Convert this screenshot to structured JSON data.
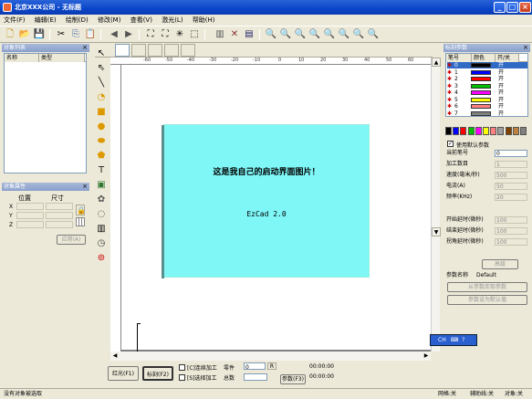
{
  "window": {
    "title": "北京XXX公司 - 无标题"
  },
  "menu": [
    "文件(F)",
    "编辑(E)",
    "绘制(D)",
    "修改(M)",
    "查看(V)",
    "激光(L)",
    "帮助(H)"
  ],
  "object_list": {
    "title": "对象列表",
    "col_name": "名称",
    "col_type": "类型"
  },
  "object_props": {
    "title": "对象属性",
    "col_pos": "位置",
    "col_size": "尺寸",
    "x": "X",
    "y": "Y",
    "z": "Z",
    "apply": "应用(A)"
  },
  "ruler_h": [
    "-60",
    "-50",
    "-40",
    "-30",
    "-20",
    "-10",
    "0",
    "10",
    "20",
    "30",
    "40",
    "50",
    "60"
  ],
  "splash": {
    "line1": "这是我自己的启动界面图片！",
    "line2": "EzCad 2.0"
  },
  "bottom": {
    "red_light": "红光(F1)",
    "mark": "标刻(F2)",
    "continuous": "[C]连续加工",
    "selected": "[S]选择加工",
    "part_label": "零件",
    "part_value": "0",
    "total_label": "总数",
    "param": "参数(F3)",
    "time1": "00:00:00",
    "time2": "00:00:00"
  },
  "pen_params": {
    "title": "标刻参数",
    "col_pen": "笔号",
    "col_color": "颜色",
    "col_onoff": "开/关",
    "pens": [
      {
        "no": "0",
        "color": "#000000",
        "state": "开"
      },
      {
        "no": "1",
        "color": "#0000ff",
        "state": "开"
      },
      {
        "no": "2",
        "color": "#ff0000",
        "state": "开"
      },
      {
        "no": "3",
        "color": "#00c000",
        "state": "开"
      },
      {
        "no": "4",
        "color": "#ff00ff",
        "state": "开"
      },
      {
        "no": "5",
        "color": "#ffff00",
        "state": "开"
      },
      {
        "no": "6",
        "color": "#ff8080",
        "state": "开"
      },
      {
        "no": "7",
        "color": "#808080",
        "state": "开"
      }
    ],
    "palette": [
      "#000000",
      "#0000ff",
      "#ff0000",
      "#00c000",
      "#ff00ff",
      "#ffff00",
      "#ff8080",
      "#a0a0a0",
      "#804000",
      "#c08040",
      "#808080"
    ],
    "use_default": "使用默认参数",
    "current_pen": "当前笔号",
    "current_pen_value": "0",
    "count": "加工数目",
    "count_value": "1",
    "speed": "速度(毫米/秒)",
    "speed_value": "500",
    "current": "电流(A)",
    "current_value": "50",
    "freq": "频率(KHz)",
    "freq_value": "20",
    "on_delay": "开始延时(微秒)",
    "on_delay_value": "100",
    "off_delay": "结束延时(微秒)",
    "off_delay_value": "100",
    "corner_delay": "拐角延时(微秒)",
    "corner_delay_value": "100",
    "advanced": "高级",
    "param_name_label": "参数名称",
    "param_name": "Default",
    "from_lib": "从参数库取参数",
    "set_default": "参数设为默认值"
  },
  "ime": {
    "label": "CH"
  },
  "status": {
    "left": "没有对象被选取",
    "grid": "网格:关",
    "guide": "辅助线:关",
    "snap": "对象:关"
  },
  "colors": {
    "title_blue": "#0a46c9",
    "splash_bg": "#7ff7f7",
    "canvas_gray": "#808080"
  }
}
